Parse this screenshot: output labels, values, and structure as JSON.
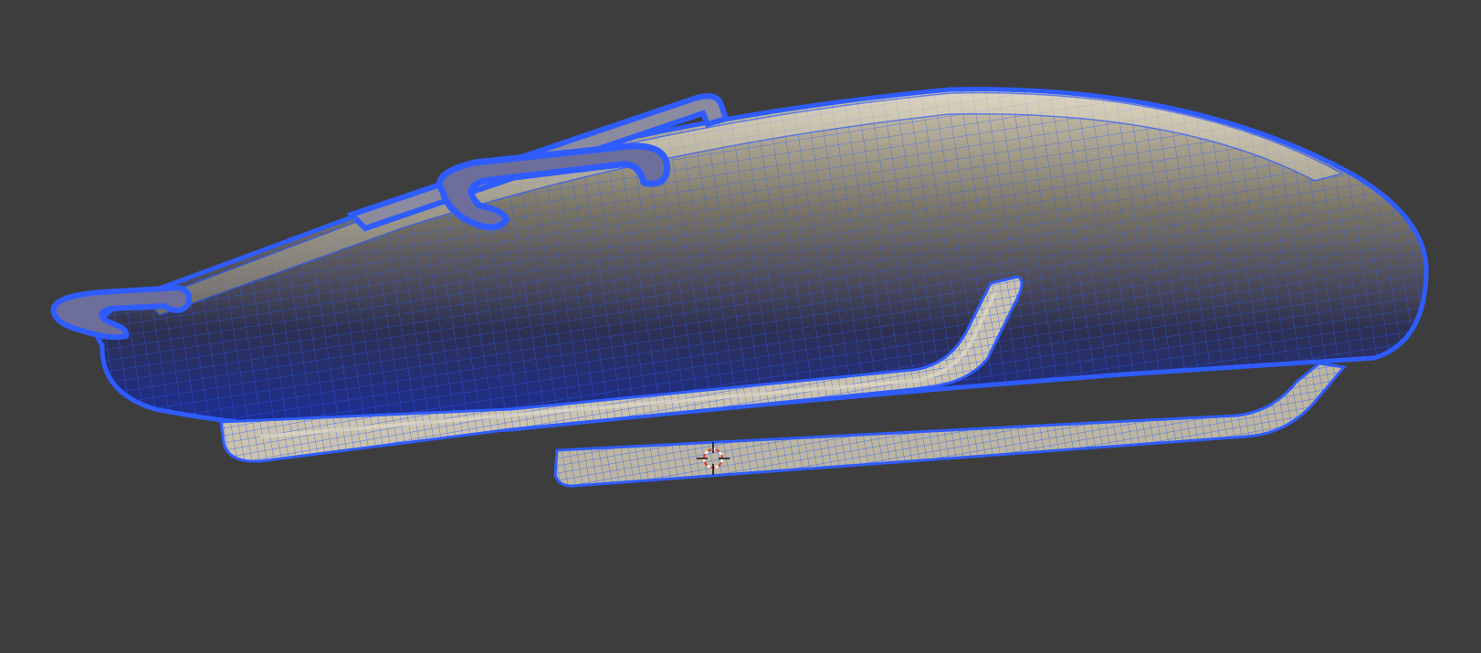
{
  "app": "Blender",
  "viewport": {
    "mode": "edit-mode-wireframe-overlay",
    "selection_state": "all-selected",
    "background_color": "#3d3d3d",
    "wire_color": "#2f5cff",
    "surface_color": "#c8c0aa"
  },
  "scene": {
    "object": "sled-shaped-mesh",
    "cursor_icon": "3d-cursor-icon"
  }
}
